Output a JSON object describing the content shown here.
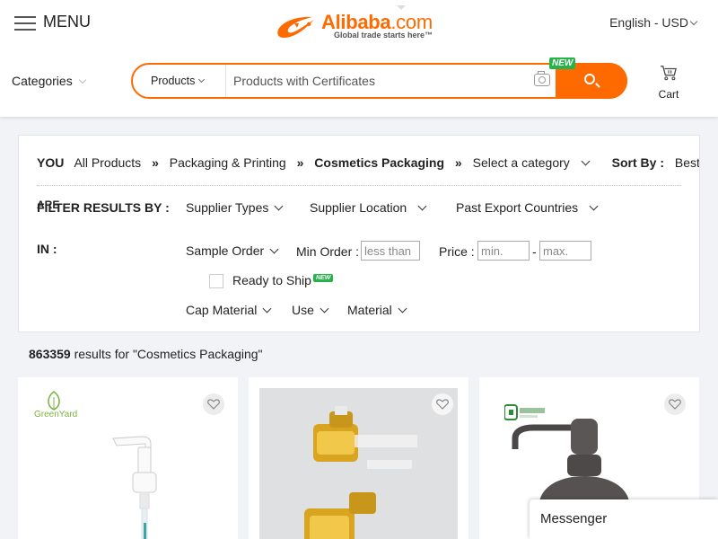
{
  "header": {
    "menu_label": "MENU",
    "logo": {
      "brand": "Alibaba",
      "brand_suffix": ".com",
      "tagline": "Global trade starts here™"
    },
    "language_currency": "English - USD",
    "categories_label": "Categories",
    "search": {
      "category": "Products",
      "placeholder": "Products with Certificates",
      "new_badge": "NEW"
    },
    "cart_label": "Cart"
  },
  "filters": {
    "breadcrumb": {
      "you_label": "YOU",
      "items": [
        "All Products",
        "Packaging & Printing",
        "Cosmetics Packaging"
      ],
      "separator": "»",
      "select_category": "Select a category",
      "sort_by_label": "Sort By :",
      "sort_value": "Best Match"
    },
    "label_are": "ARE",
    "label_filter": "FILTER RESULTS BY :",
    "label_in": "IN :",
    "row1": [
      "Supplier Types",
      "Supplier Location",
      "Past Export Countries"
    ],
    "sample_order": "Sample Order",
    "min_order_label": "Min Order :",
    "min_order_placeholder": "less than",
    "price_label": "Price :",
    "price_min_placeholder": "min.",
    "price_dash": "-",
    "price_max_placeholder": "max.",
    "ready_to_ship": "Ready to Ship",
    "ready_new_badge": "NEW",
    "row3": [
      "Cap Material",
      "Use",
      "Material"
    ]
  },
  "results": {
    "count": "863359",
    "text": " results for \"Cosmetics Packaging\""
  },
  "cards": [
    {
      "logo_text": "GreenYard"
    },
    {
      "logo_text": ""
    },
    {
      "logo_text": ""
    }
  ],
  "messenger_label": "Messenger",
  "colors": {
    "accent": "#ff6a00",
    "new_badge": "#25b34a"
  }
}
